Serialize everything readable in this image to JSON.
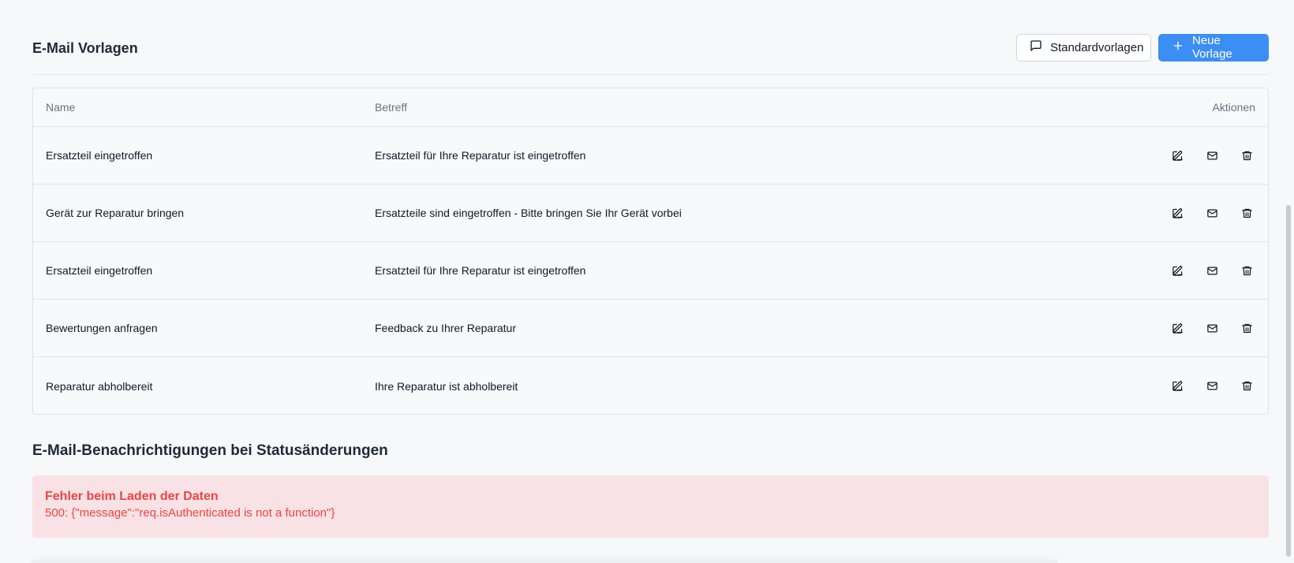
{
  "header": {
    "title": "E-Mail Vorlagen",
    "standard_templates_label": "Standardvorlagen",
    "new_template_label": "Neue Vorlage"
  },
  "table": {
    "columns": [
      "Name",
      "Betreff",
      "Aktionen"
    ],
    "rows": [
      {
        "name": "Ersatzteil eingetroffen",
        "subject": "Ersatzteil für Ihre Reparatur ist eingetroffen"
      },
      {
        "name": "Gerät zur Reparatur bringen",
        "subject": "Ersatzteile sind eingetroffen - Bitte bringen Sie Ihr Gerät vorbei"
      },
      {
        "name": "Ersatzteil eingetroffen",
        "subject": "Ersatzteil für Ihre Reparatur ist eingetroffen"
      },
      {
        "name": "Bewertungen anfragen",
        "subject": "Feedback zu Ihrer Reparatur"
      },
      {
        "name": "Reparatur abholbereit",
        "subject": "Ihre Reparatur ist abholbereit"
      }
    ]
  },
  "notifications": {
    "title": "E-Mail-Benachrichtigungen bei Statusänderungen",
    "error_title": "Fehler beim Laden der Daten",
    "error_message": "500: {\"message\":\"req.isAuthenticated is not a function\"}"
  },
  "icons": {
    "standard_templates": "message-square-icon",
    "new_template": "plus-icon",
    "edit": "edit-icon",
    "send": "mail-icon",
    "delete": "trash-icon"
  },
  "colors": {
    "background": "#f7f8fa",
    "primary": "#3b8ef3",
    "error_background": "#f9e2e5",
    "error_text": "#ef4444",
    "border": "#dfe3e8"
  }
}
